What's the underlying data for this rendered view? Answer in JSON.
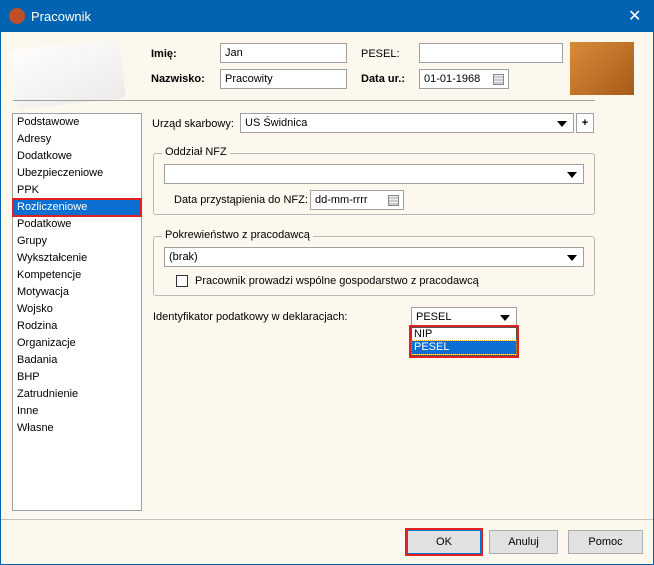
{
  "window": {
    "title": "Pracownik",
    "close": "✕",
    "app_icon": "GT"
  },
  "header": {
    "imie_label": "Imię:",
    "imie_value": "Jan",
    "nazwisko_label": "Nazwisko:",
    "nazwisko_value": "Pracowity",
    "pesel_label": "PESEL:",
    "pesel_value": "",
    "data_label": "Data ur.:",
    "data_value": "01-01-1968"
  },
  "sidebar": {
    "items": [
      "Podstawowe",
      "Adresy",
      "Dodatkowe",
      "Ubezpieczeniowe",
      "PPK",
      "Rozliczeniowe",
      "Podatkowe",
      "Grupy",
      "Wykształcenie",
      "Kompetencje",
      "Motywacja",
      "Wojsko",
      "Rodzina",
      "Organizacje",
      "Badania",
      "BHP",
      "Zatrudnienie",
      "Inne",
      "Własne"
    ],
    "selected": "Rozliczeniowe"
  },
  "main": {
    "urzad_label": "Urząd skarbowy:",
    "urzad_value": "US Świdnica",
    "add": "+",
    "nfz_group": "Oddział NFZ",
    "nfz_value": "",
    "nfz_date_label": "Data przystąpienia do NFZ:",
    "nfz_date_value": "dd-mm-rrrr",
    "pokrew_group": "Pokrewieństwo z pracodawcą",
    "pokrew_value": "(brak)",
    "gosp_label": "Pracownik prowadzi wspólne gospodarstwo z pracodawcą",
    "ident_label": "Identyfikator podatkowy w deklaracjach:",
    "ident_value": "PESEL",
    "ident_options": [
      "NIP",
      "PESEL"
    ]
  },
  "buttons": {
    "ok": "OK",
    "cancel": "Anuluj",
    "help": "Pomoc"
  },
  "colors": {
    "accent": "#0063b1",
    "highlight": "#e02020",
    "background": "#fdf8ee"
  }
}
